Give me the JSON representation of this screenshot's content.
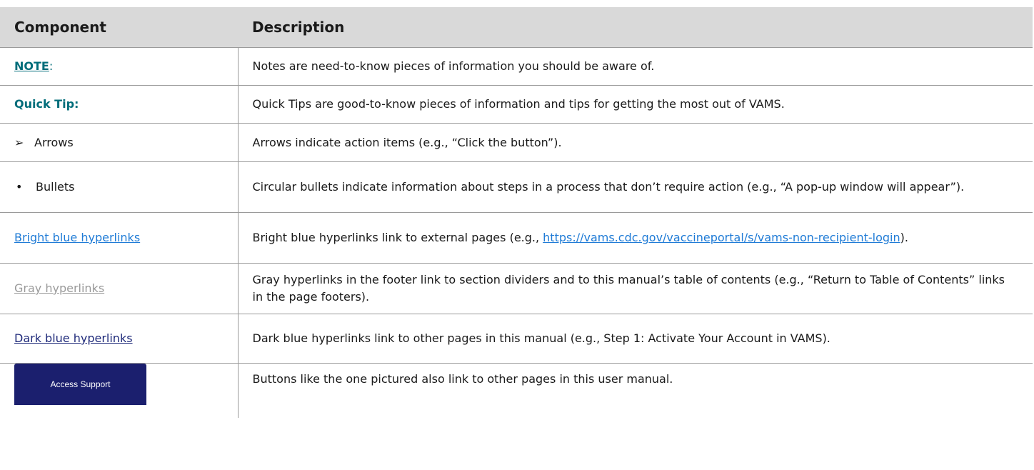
{
  "header": {
    "component": "Component",
    "description": "Description"
  },
  "rows": [
    {
      "component": {
        "link": "NOTE",
        "suffix": ":"
      },
      "description": "Notes are need-to-know pieces of information you should be aware of."
    },
    {
      "component": "Quick Tip:",
      "description": "Quick Tips are good-to-know pieces of information and tips for getting the most out of VAMS."
    },
    {
      "component": {
        "glyph": "➢",
        "label": "Arrows"
      },
      "description": "Arrows indicate action items (e.g., “Click the button”)."
    },
    {
      "component": {
        "glyph": "•",
        "label": "Bullets"
      },
      "description": "Circular bullets indicate information about steps in a process that don’t require action (e.g., “A pop-up window will appear”)."
    },
    {
      "component": "Bright blue hyperlinks",
      "description": {
        "before": "Bright blue hyperlinks link to external pages (e.g., ",
        "link": "https://vams.cdc.gov/vaccineportal/s/vams-non-recipient-login",
        "after": ")."
      }
    },
    {
      "component": "Gray hyperlinks",
      "description": "Gray hyperlinks in the footer link to section dividers and to this manual’s table of contents (e.g., “Return to Table of Contents” links in the page footers)."
    },
    {
      "component": "Dark blue hyperlinks",
      "description": "Dark blue hyperlinks link to other pages in this manual (e.g., Step 1: Activate Your Account in VAMS)."
    },
    {
      "component": {
        "button": "Access Support"
      },
      "description": "Buttons like the one pictured also link to other pages in this user manual."
    }
  ],
  "colors": {
    "header_bg": "#d9d9d9",
    "teal": "#006d7a",
    "bright_blue": "#1f7bd6",
    "gray_link": "#9a9a9a",
    "dark_blue": "#1f2a7a",
    "button_bg": "#1b1f6e"
  },
  "icons": {
    "arrow": "arrow-bullet-icon",
    "bullet": "circle-bullet-icon"
  }
}
